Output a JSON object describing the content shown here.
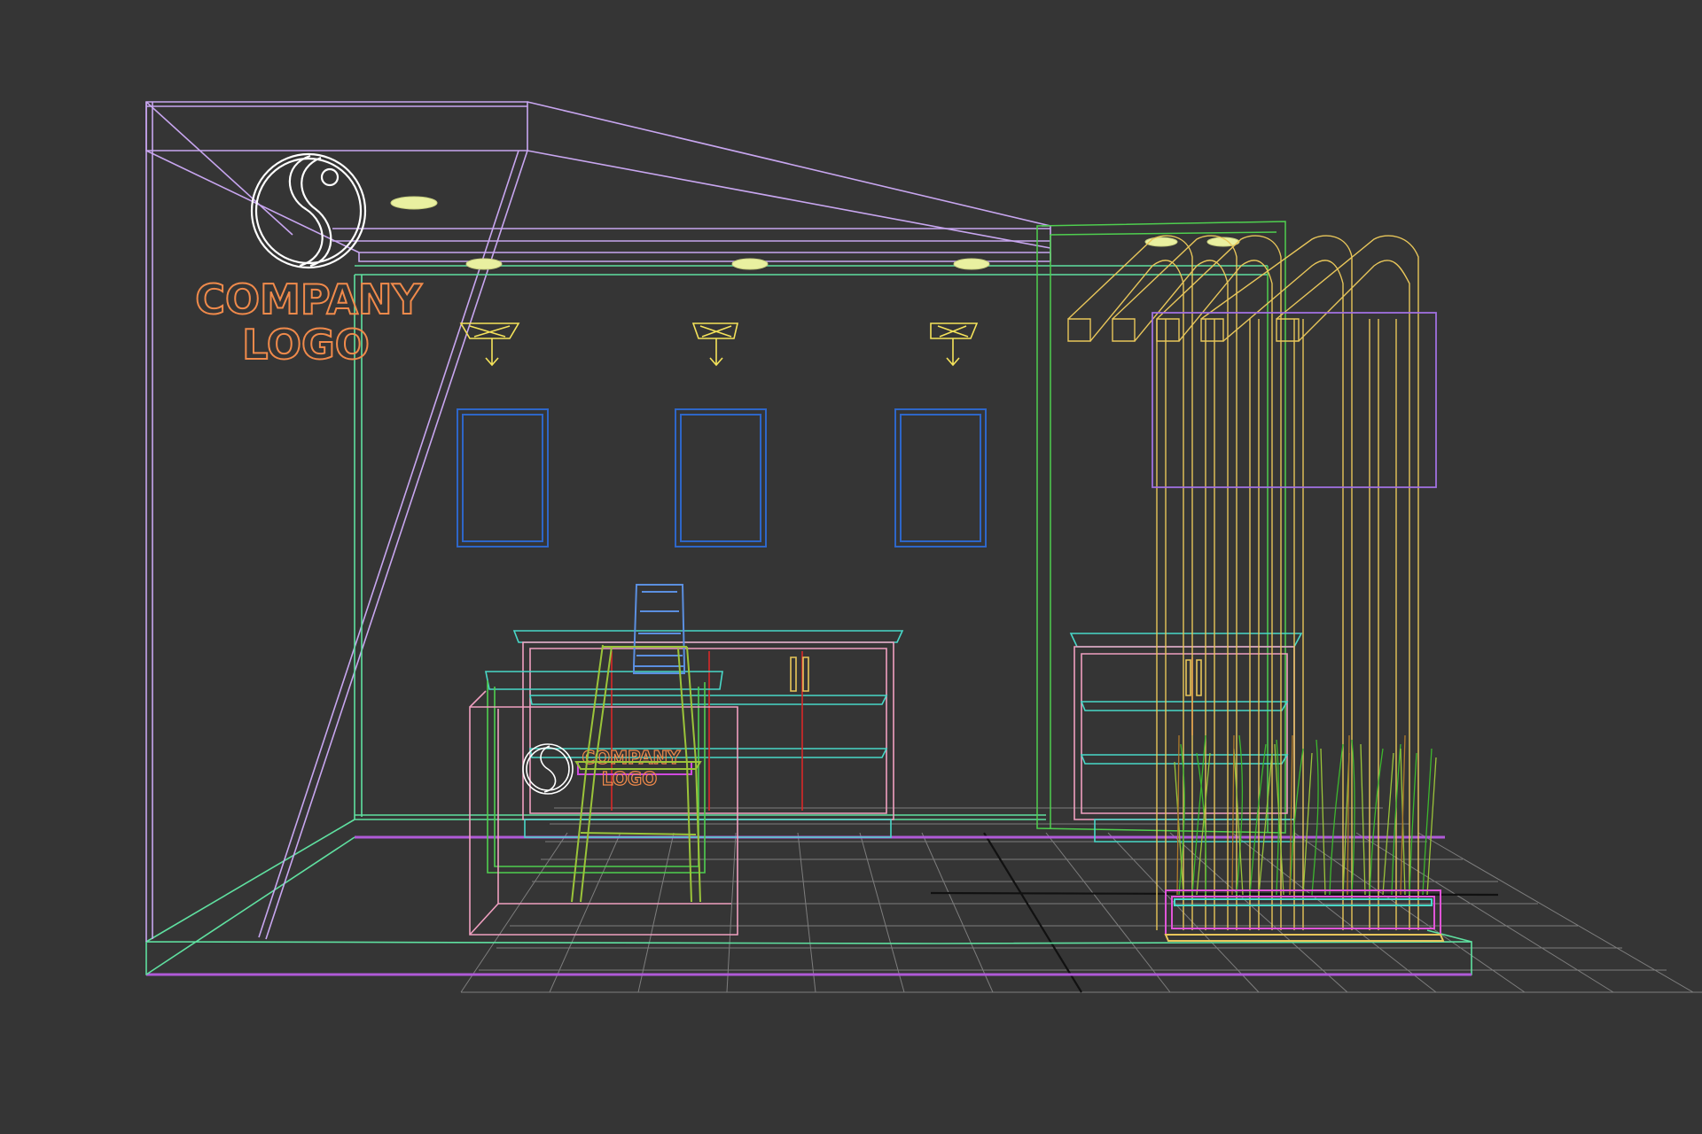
{
  "viewport": {
    "background": "#353535",
    "render_mode": "wireframe",
    "view": "perspective"
  },
  "scene": {
    "wall_sign": {
      "logo_icon": "yin-yang-s-icon",
      "line1": "COMPANY",
      "line2": "LOGO",
      "color": "#F08A4B"
    },
    "counter_sign": {
      "logo_icon": "yin-yang-s-icon",
      "line1": "COMPANY",
      "line2": "LOGO",
      "color": "#F08A4B"
    },
    "objects": [
      "booth-structure",
      "back-wall",
      "ceiling-downlights",
      "spotlights",
      "wall-frames",
      "display-shelf-left",
      "display-shelf-right",
      "reception-counter",
      "bar-chair",
      "bamboo-partition",
      "planter-box",
      "floor-grid"
    ],
    "colors": {
      "booth_outline": "#C8A6F0",
      "wall_outline": "#5FE0A0",
      "frames": "#2E66C8",
      "spotlights": "#F5E35A",
      "downlights": "#E9F0A0",
      "shelves_frame": "#F0A0C0",
      "shelves_glass": "#48D8C8",
      "chair": "#9BC43A",
      "bamboo": "#E8C65A",
      "plants": "#3DB82E",
      "floor_grid": "#8A8A8A"
    }
  }
}
